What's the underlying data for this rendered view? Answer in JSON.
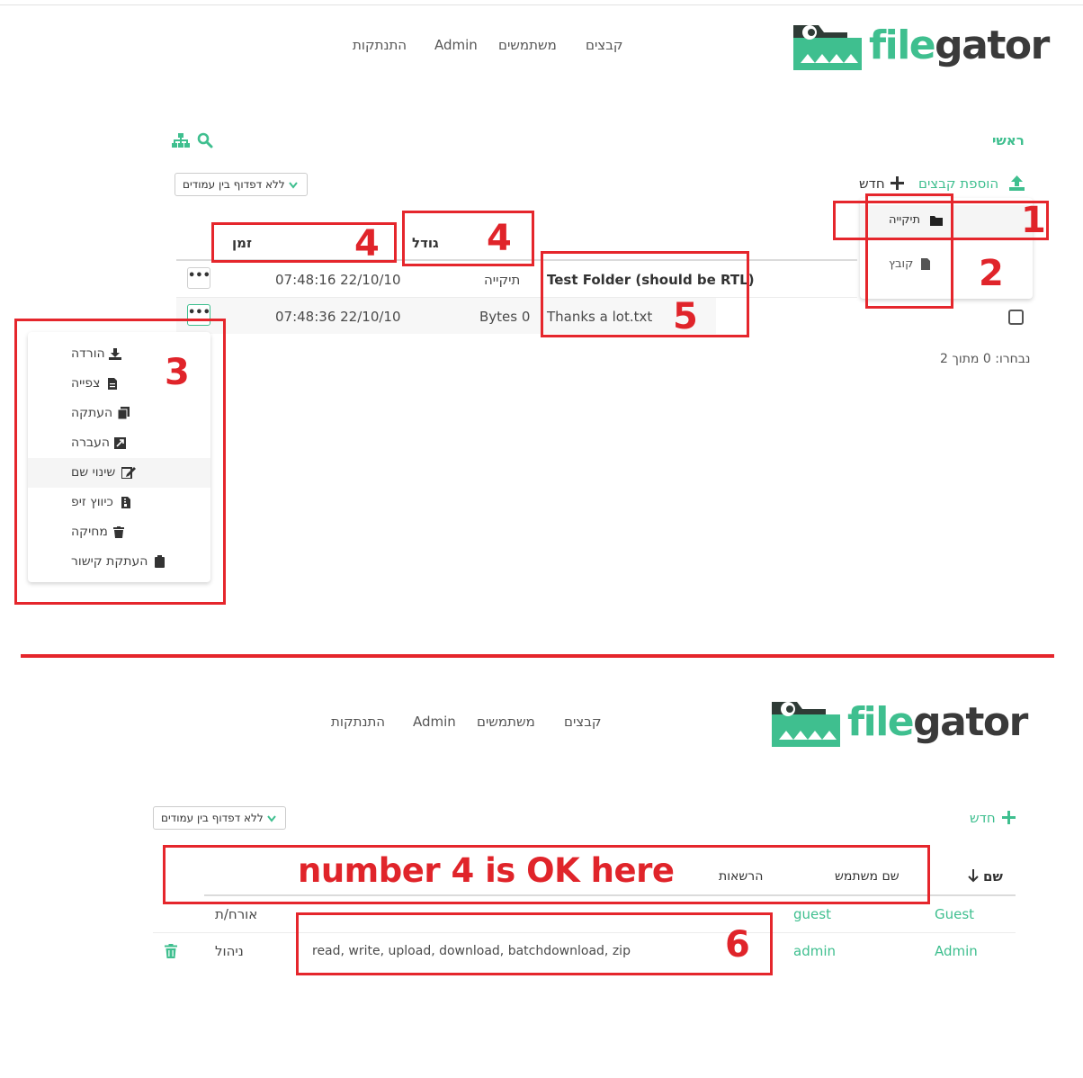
{
  "app": {
    "logo_text_a": "file",
    "logo_text_b": "gator",
    "nav": {
      "files": "קבצים",
      "users": "משתמשים",
      "admin": "Admin",
      "logout": "התנתקות"
    }
  },
  "files_view": {
    "breadcrumb_home": "ראשי",
    "add_files": "הוספת קבצים",
    "new": "חדש",
    "pagination_select": "ללא דפדוף בין עמודים",
    "new_menu": {
      "folder": "תיקייה",
      "file": "קובץ"
    },
    "columns": {
      "size": "גודל",
      "time": "זמן"
    },
    "rows": [
      {
        "name": "Test Folder (should be RTL)",
        "size": "תיקייה",
        "time": "07:48:16 22/10/10"
      },
      {
        "name": "Thanks a lot.txt",
        "size": "Bytes 0",
        "time": "07:48:36 22/10/10"
      }
    ],
    "selection_count": "נבחרו: 0 מתוך 2",
    "row_menu": [
      "הורדה",
      "צפייה",
      "העתקה",
      "העברה",
      "שינוי שם",
      "כיווץ זיפ",
      "מחיקה",
      "העתקת קישור"
    ],
    "more_label": "•••"
  },
  "users_view": {
    "new": "חדש",
    "pagination_select": "ללא דפדוף בין עמודים",
    "columns": {
      "name": "שם",
      "username": "שם משתמש",
      "permissions": "הרשאות"
    },
    "rows": [
      {
        "name": "Guest",
        "username": "guest",
        "permissions": "",
        "role": "אורח/ת"
      },
      {
        "name": "Admin",
        "username": "admin",
        "permissions": "read, write, upload, download, batchdownload, zip",
        "role": "ניהול"
      }
    ]
  },
  "annotations": {
    "n1": "1",
    "n2": "2",
    "n3": "3",
    "n4a": "4",
    "n4b": "4",
    "n5": "5",
    "n6": "6",
    "ok_text": "number 4 is OK here"
  },
  "colors": {
    "accent": "#3fbf8f",
    "annotation": "#e5262c"
  }
}
